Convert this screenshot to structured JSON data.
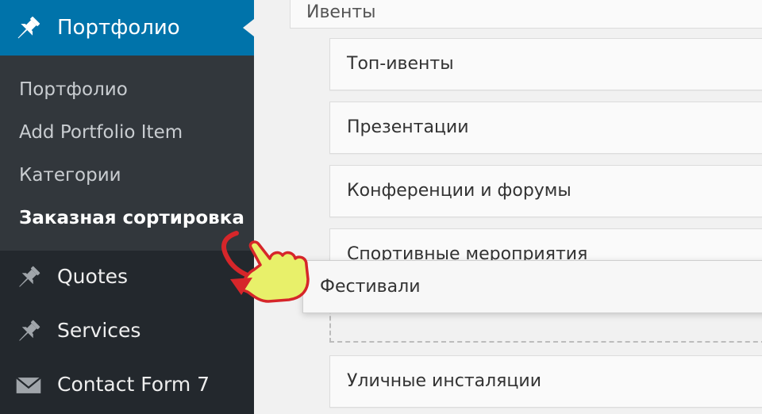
{
  "sidebar": {
    "active_menu": {
      "label": "Портфолио",
      "icon": "pushpin-icon"
    },
    "submenu": [
      {
        "label": "Портфолио",
        "current": false
      },
      {
        "label": "Add Portfolio Item",
        "current": false
      },
      {
        "label": "Категории",
        "current": false
      },
      {
        "label": "Заказная сортировка",
        "current": true
      }
    ],
    "items": [
      {
        "label": "Quotes",
        "icon": "pushpin-icon"
      },
      {
        "label": "Services",
        "icon": "pushpin-icon"
      },
      {
        "label": "Contact Form 7",
        "icon": "envelope-icon"
      }
    ]
  },
  "content": {
    "parent_item": "Ивенты",
    "items": [
      "Топ-ивенты",
      "Презентации",
      "Конференции и форумы",
      "Спортивные мероприятия"
    ],
    "dragging_item": "Фестивали",
    "after_placeholder": "Уличные инсталяции"
  },
  "colors": {
    "sidebar_bg": "#23282d",
    "submenu_bg": "#32373c",
    "active_bg": "#0073aa",
    "hand_fill": "#e8f06a",
    "hand_outline": "#d6262a"
  }
}
